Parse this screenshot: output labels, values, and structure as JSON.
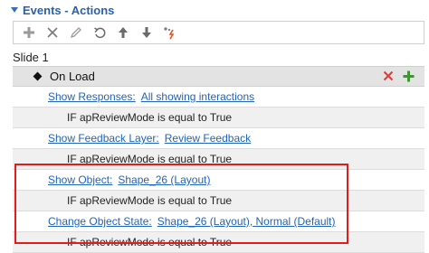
{
  "header": {
    "title": "Events - Actions"
  },
  "toolbar": {
    "buttons": [
      {
        "icon": "plus-icon"
      },
      {
        "icon": "close-icon"
      },
      {
        "icon": "pencil-icon"
      },
      {
        "icon": "undo-icon"
      },
      {
        "icon": "arrow-up-icon"
      },
      {
        "icon": "arrow-down-icon"
      },
      {
        "icon": "magic-icon"
      }
    ]
  },
  "slide": {
    "label": "Slide 1"
  },
  "event": {
    "name": "On Load"
  },
  "actions": [
    {
      "action": "Show Responses:",
      "target": "All showing interactions",
      "condition": "IF apReviewMode is equal to True"
    },
    {
      "action": "Show Feedback Layer:",
      "target": "Review Feedback",
      "condition": "IF apReviewMode is equal to True"
    },
    {
      "action": "Show Object:",
      "target": "Shape_26 (Layout)",
      "condition": "IF apReviewMode is equal to True"
    },
    {
      "action": "Change Object State:",
      "target": "Shape_26 (Layout), Normal (Default)",
      "condition": "IF apReviewMode is equal to True"
    }
  ],
  "colors": {
    "accent": "#2b61a8",
    "link": "#1f64b8",
    "highlight": "#e21b1b",
    "delete": "#e03a3a",
    "add": "#3a9a2a"
  }
}
